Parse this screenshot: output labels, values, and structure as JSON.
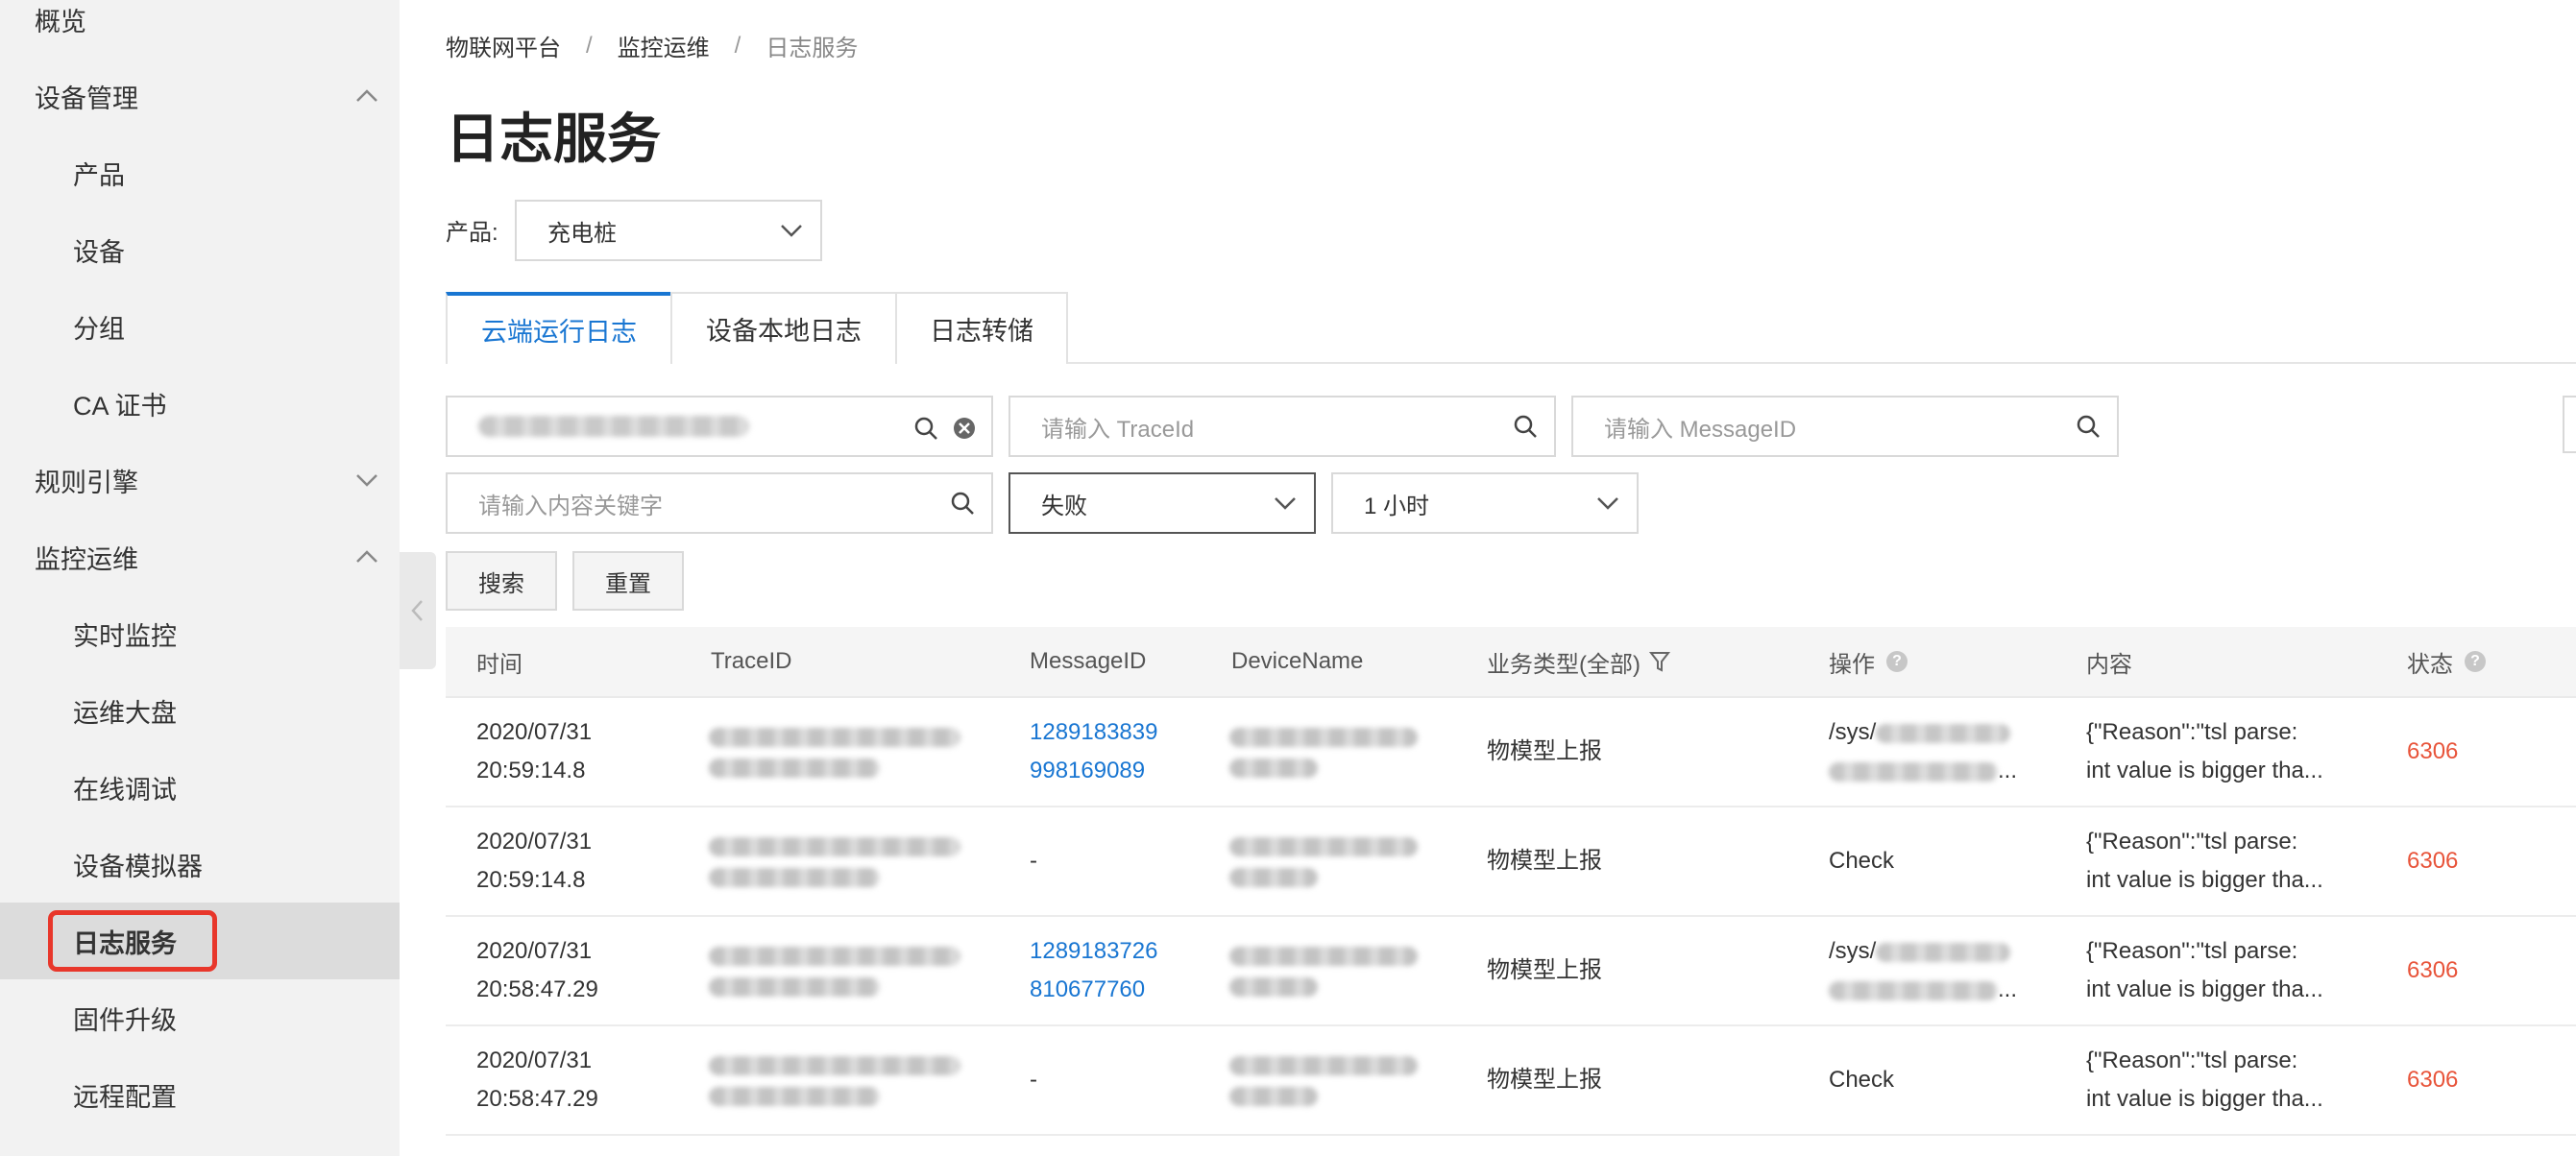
{
  "sidebar": {
    "items": [
      {
        "label": "概览",
        "type": "group"
      },
      {
        "label": "设备管理",
        "type": "group",
        "chevron": "up"
      },
      {
        "label": "产品",
        "type": "sub"
      },
      {
        "label": "设备",
        "type": "sub"
      },
      {
        "label": "分组",
        "type": "sub"
      },
      {
        "label": "CA 证书",
        "type": "sub"
      },
      {
        "label": "规则引擎",
        "type": "group",
        "chevron": "down"
      },
      {
        "label": "监控运维",
        "type": "group",
        "chevron": "up"
      },
      {
        "label": "实时监控",
        "type": "sub"
      },
      {
        "label": "运维大盘",
        "type": "sub"
      },
      {
        "label": "在线调试",
        "type": "sub"
      },
      {
        "label": "设备模拟器",
        "type": "sub"
      },
      {
        "label": "日志服务",
        "type": "sub",
        "active": true
      },
      {
        "label": "固件升级",
        "type": "sub"
      },
      {
        "label": "远程配置",
        "type": "sub"
      }
    ]
  },
  "breadcrumb": {
    "items": [
      "物联网平台",
      "监控运维",
      "日志服务"
    ],
    "separator": "/"
  },
  "page_title": "日志服务",
  "product": {
    "label": "产品:",
    "value": "充电桩"
  },
  "tabs": [
    {
      "label": "云端运行日志",
      "active": true
    },
    {
      "label": "设备本地日志"
    },
    {
      "label": "日志转储"
    }
  ],
  "filters": {
    "trace_placeholder": "请输入 TraceId",
    "message_placeholder": "请输入 MessageID",
    "keyword_placeholder": "请输入内容关键字",
    "status_value": "失败",
    "time_value": "1 小时"
  },
  "buttons": {
    "search": "搜索",
    "reset": "重置"
  },
  "table": {
    "headers": {
      "time": "时间",
      "trace_id": "TraceID",
      "message_id": "MessageID",
      "device_name": "DeviceName",
      "biz_type": "业务类型(全部)",
      "operation": "操作",
      "content": "内容",
      "status": "状态"
    },
    "rows": [
      {
        "time1": "2020/07/31",
        "time2": "20:59:14.8",
        "msg1": "1289183839",
        "msg2": "998169089",
        "biz": "物模型上报",
        "op1": "/sys/",
        "op2": "...",
        "content1": "{\"Reason\":\"tsl parse:",
        "content2": "int value is bigger tha...",
        "status": "6306"
      },
      {
        "time1": "2020/07/31",
        "time2": "20:59:14.8",
        "msg1": "-",
        "msg2": "",
        "biz": "物模型上报",
        "op1": "Check",
        "op2": "",
        "content1": "{\"Reason\":\"tsl parse:",
        "content2": "int value is bigger tha...",
        "status": "6306"
      },
      {
        "time1": "2020/07/31",
        "time2": "20:58:47.29",
        "msg1": "1289183726",
        "msg2": "810677760",
        "biz": "物模型上报",
        "op1": "/sys/",
        "op2": "...",
        "content1": "{\"Reason\":\"tsl parse:",
        "content2": "int value is bigger tha...",
        "status": "6306"
      },
      {
        "time1": "2020/07/31",
        "time2": "20:58:47.29",
        "msg1": "-",
        "msg2": "",
        "biz": "物模型上报",
        "op1": "Check",
        "op2": "",
        "content1": "{\"Reason\":\"tsl parse:",
        "content2": "int value is bigger tha...",
        "status": "6306"
      }
    ]
  },
  "colors": {
    "accent": "#1976d2",
    "status_error": "#e8543a",
    "highlight_box": "#e8372b"
  }
}
